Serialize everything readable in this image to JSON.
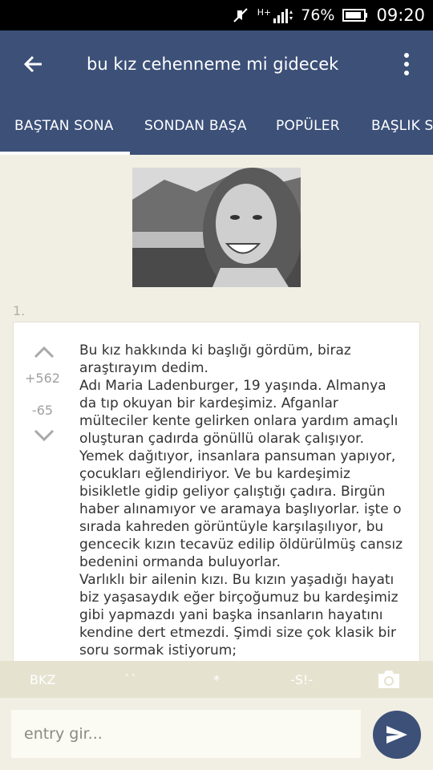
{
  "status_bar": {
    "network": "H+",
    "battery": "76%",
    "time": "09:20"
  },
  "header": {
    "title": "bu kız cehenneme mi gidecek"
  },
  "tabs": [
    {
      "label": "BAŞTAN SONA"
    },
    {
      "label": "SONDAN BAŞA"
    },
    {
      "label": "POPÜLER"
    },
    {
      "label": "BAŞLIK S"
    }
  ],
  "entry": {
    "number": "1.",
    "upvotes": "+562",
    "downvotes": "-65",
    "text": "Bu kız hakkında ki başlığı gördüm, biraz araştırayım dedim.\nAdı Maria Ladenburger, 19 yaşında. Almanya da tıp okuyan bir kardeşimiz. Afganlar mülteciler kente gelirken onlara yardım amaçlı oluşturan çadırda gönüllü olarak çalışıyor. Yemek dağıtıyor, insanlara pansuman yapıyor, çocukları eğlendiriyor. Ve bu kardeşimiz bisikletle gidip geliyor çalıştığı çadıra. Birgün haber alınamıyor ve aramaya başlıyorlar. işte o sırada kahreden görüntüyle karşılaşılıyor, bu gencecik kızın tecavüz edilip öldürülmüş cansız bedenini ormanda buluyorlar.\nVarlıklı bir ailenin kızı. Bu kızın yaşadığı hayatı biz yaşasaydık eğer birçoğumuz bu kardeşimiz gibi yapmazdı yani başka insanların hayatını kendine dert etmezdi. Şimdi size çok klasik bir soru sormak istiyorum;"
  },
  "toolbar": {
    "bkz": "BKZ",
    "hede": "``",
    "star": "*",
    "spoiler": "-S!-"
  },
  "input": {
    "placeholder": "entry gir..."
  }
}
